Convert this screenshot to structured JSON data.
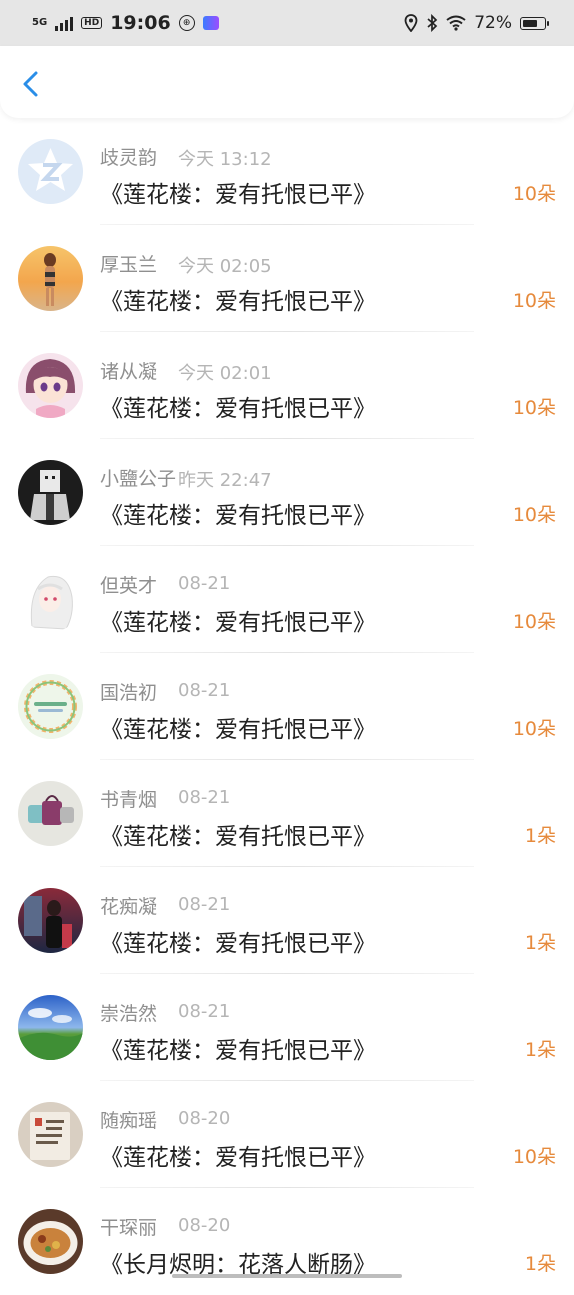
{
  "status_bar": {
    "network": "5G",
    "hd": "HD",
    "time": "19:06",
    "battery": "72%",
    "battery_level": 0.72
  },
  "header": {
    "back_icon": "chevron-left-icon"
  },
  "colors": {
    "accent": "#2a8ee8",
    "count": "#e68a3c"
  },
  "items": [
    {
      "name": "歧灵韵",
      "time": "今天 13:12",
      "title": "《莲花楼：爱有托恨已平》",
      "count": "10朵"
    },
    {
      "name": "厚玉兰",
      "time": "今天 02:05",
      "title": "《莲花楼：爱有托恨已平》",
      "count": "10朵"
    },
    {
      "name": "诸从凝",
      "time": "今天 02:01",
      "title": "《莲花楼：爱有托恨已平》",
      "count": "10朵"
    },
    {
      "name": "小鹽公子",
      "time": "昨天 22:47",
      "title": "《莲花楼：爱有托恨已平》",
      "count": "10朵"
    },
    {
      "name": "但英才",
      "time": "08-21",
      "title": "《莲花楼：爱有托恨已平》",
      "count": "10朵"
    },
    {
      "name": "国浩初",
      "time": "08-21",
      "title": "《莲花楼：爱有托恨已平》",
      "count": "10朵"
    },
    {
      "name": "书青烟",
      "time": "08-21",
      "title": "《莲花楼：爱有托恨已平》",
      "count": "1朵"
    },
    {
      "name": "花痴凝",
      "time": "08-21",
      "title": "《莲花楼：爱有托恨已平》",
      "count": "1朵"
    },
    {
      "name": "崇浩然",
      "time": "08-21",
      "title": "《莲花楼：爱有托恨已平》",
      "count": "1朵"
    },
    {
      "name": "随痴瑶",
      "time": "08-20",
      "title": "《莲花楼：爱有托恨已平》",
      "count": "10朵"
    },
    {
      "name": "干琛丽",
      "time": "08-20",
      "title": "《长月烬明：花落人断肠》",
      "count": "1朵"
    }
  ]
}
